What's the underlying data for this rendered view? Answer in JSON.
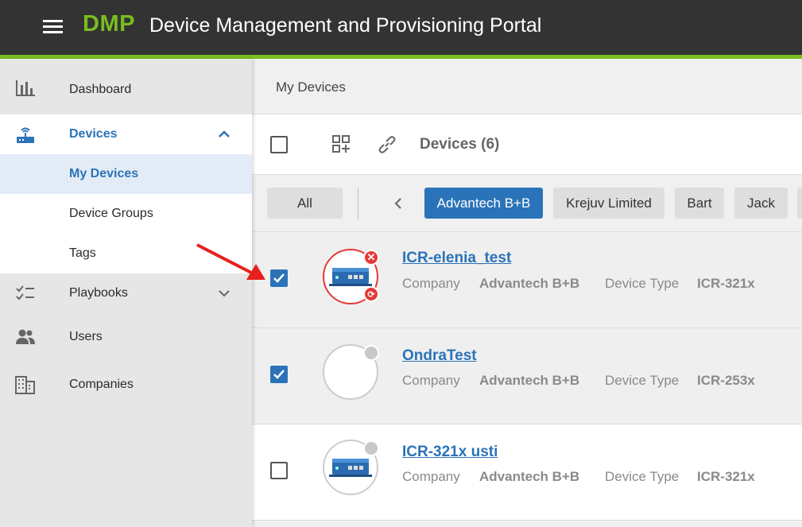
{
  "header": {
    "logo": "DMP",
    "title": "Device Management and Provisioning Portal"
  },
  "sidebar": {
    "items": [
      {
        "label": "Dashboard",
        "icon": "bar-chart-icon"
      },
      {
        "label": "Devices",
        "icon": "router-icon",
        "expanded": true
      },
      {
        "label": "Playbooks",
        "icon": "checklist-icon"
      },
      {
        "label": "Users",
        "icon": "users-icon"
      },
      {
        "label": "Companies",
        "icon": "building-icon"
      }
    ],
    "devices_sub": [
      {
        "label": "My Devices",
        "active": true
      },
      {
        "label": "Device Groups"
      },
      {
        "label": "Tags"
      }
    ]
  },
  "breadcrumb": "My Devices",
  "toolbar": {
    "devices_label": "Devices (6)"
  },
  "filters": [
    "All",
    "Advantech B+B",
    "Krejuv Limited",
    "Bart",
    "Jack"
  ],
  "active_filter": "Advantech B+B",
  "labels": {
    "company": "Company",
    "device_type": "Device Type"
  },
  "devices": [
    {
      "name": "ICR-elenia_test",
      "company": "Advantech B+B",
      "device_type": "ICR-321x",
      "checked": true,
      "status": "error"
    },
    {
      "name": "OndraTest",
      "company": "Advantech B+B",
      "device_type": "ICR-253x",
      "checked": true,
      "status": "offline"
    },
    {
      "name": "ICR-321x usti",
      "company": "Advantech B+B",
      "device_type": "ICR-321x",
      "checked": false,
      "status": "offline"
    }
  ],
  "colors": {
    "brand_green": "#78be20",
    "header_bg": "#333333",
    "accent_blue": "#2b73b8",
    "error_red": "#e53935"
  }
}
